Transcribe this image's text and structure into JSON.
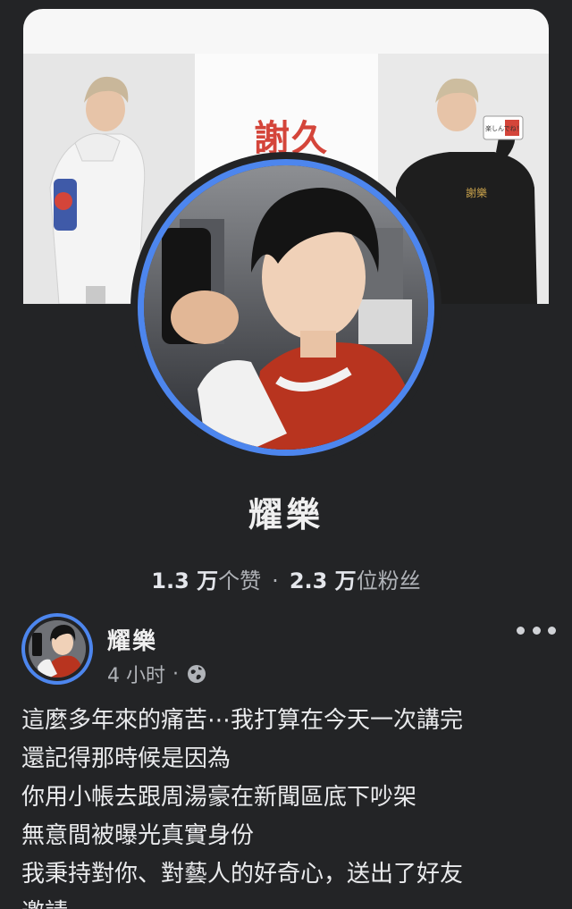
{
  "cover": {
    "logo_text": "謝久",
    "right_sign_text": "楽しんでね！",
    "shirt_logo_text": "謝樂"
  },
  "page": {
    "name": "耀樂",
    "likes_count": "1.3 万",
    "likes_label": "个赞",
    "separator": "·",
    "followers_count": "2.3 万",
    "followers_label": "位粉丝"
  },
  "post": {
    "author": "耀樂",
    "time": "4 小时",
    "meta_separator": "·",
    "privacy_icon": "globe-icon",
    "more_icon": "more-options-icon",
    "lines": [
      "這麼多年來的痛苦⋯我打算在今天一次講完",
      "還記得那時候是因為",
      "你用小帳去跟周湯豪在新聞區底下吵架",
      "無意間被曝光真實身份",
      "我秉持對你、對藝人的好奇心，送出了好友",
      "邀請"
    ]
  },
  "colors": {
    "background": "#232426",
    "ring_blue": "#4d86ee",
    "text_primary": "#e4e6eb",
    "text_secondary": "#b0b3b8",
    "logo_red": "#d4453a"
  }
}
